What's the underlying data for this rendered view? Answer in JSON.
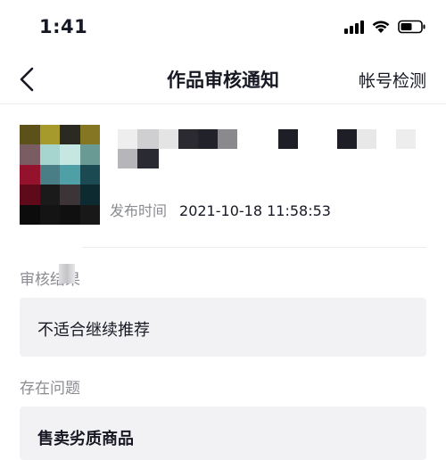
{
  "status_bar": {
    "time": "1:41",
    "icons": [
      "signal-icon",
      "wifi-icon",
      "battery-icon"
    ]
  },
  "nav": {
    "back_icon": "chevron-left-icon",
    "title": "作品审核通知",
    "right_action": "帐号检测"
  },
  "work": {
    "cover": "blurred-thumbnail",
    "title": "",
    "publish_label": "发布时间",
    "publish_time": "2021-10-18 11:58:53"
  },
  "review": {
    "result_label": "审核结果",
    "result_value": "不适合继续推荐",
    "issue_label": "存在问题",
    "issue_value": "售卖劣质商品"
  },
  "colors": {
    "text_primary": "#161823",
    "text_secondary": "#8a8b91",
    "box_background": "#f2f2f4",
    "divider": "#ececec"
  }
}
